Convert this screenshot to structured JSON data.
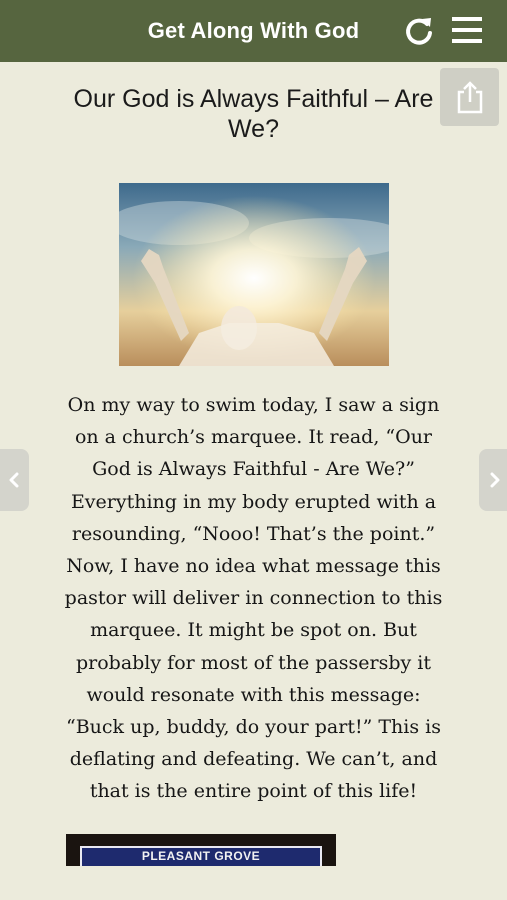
{
  "header": {
    "title": "Get Along With God",
    "refresh_icon": "refresh-icon",
    "menu_icon": "hamburger-menu-icon"
  },
  "toolbar": {
    "share_icon": "share-icon"
  },
  "article": {
    "title": "Our God is Always Faithful – Are We?",
    "body": "On my way to swim today, I saw a sign on a church’s marquee. It read, “Our God is Always Faithful - Are We?” Everything in my body erupted with a resounding, “Nooo! That’s the point.” Now, I have no idea what message this pastor will deliver in connection to this marquee. It might be spot on. But probably for most of the passersby it would resonate with this message: “Buck up, buddy, do your part!” This is deflating and defeating. We can’t, and that is the entire point of this life!",
    "second_image_sign_text": "PLEASANT GROVE"
  },
  "navigation": {
    "prev_icon": "chevron-left-icon",
    "next_icon": "chevron-right-icon"
  },
  "colors": {
    "header_bg": "#56653f",
    "page_bg": "#ecebdc",
    "button_bg": "#d4d4cc"
  }
}
